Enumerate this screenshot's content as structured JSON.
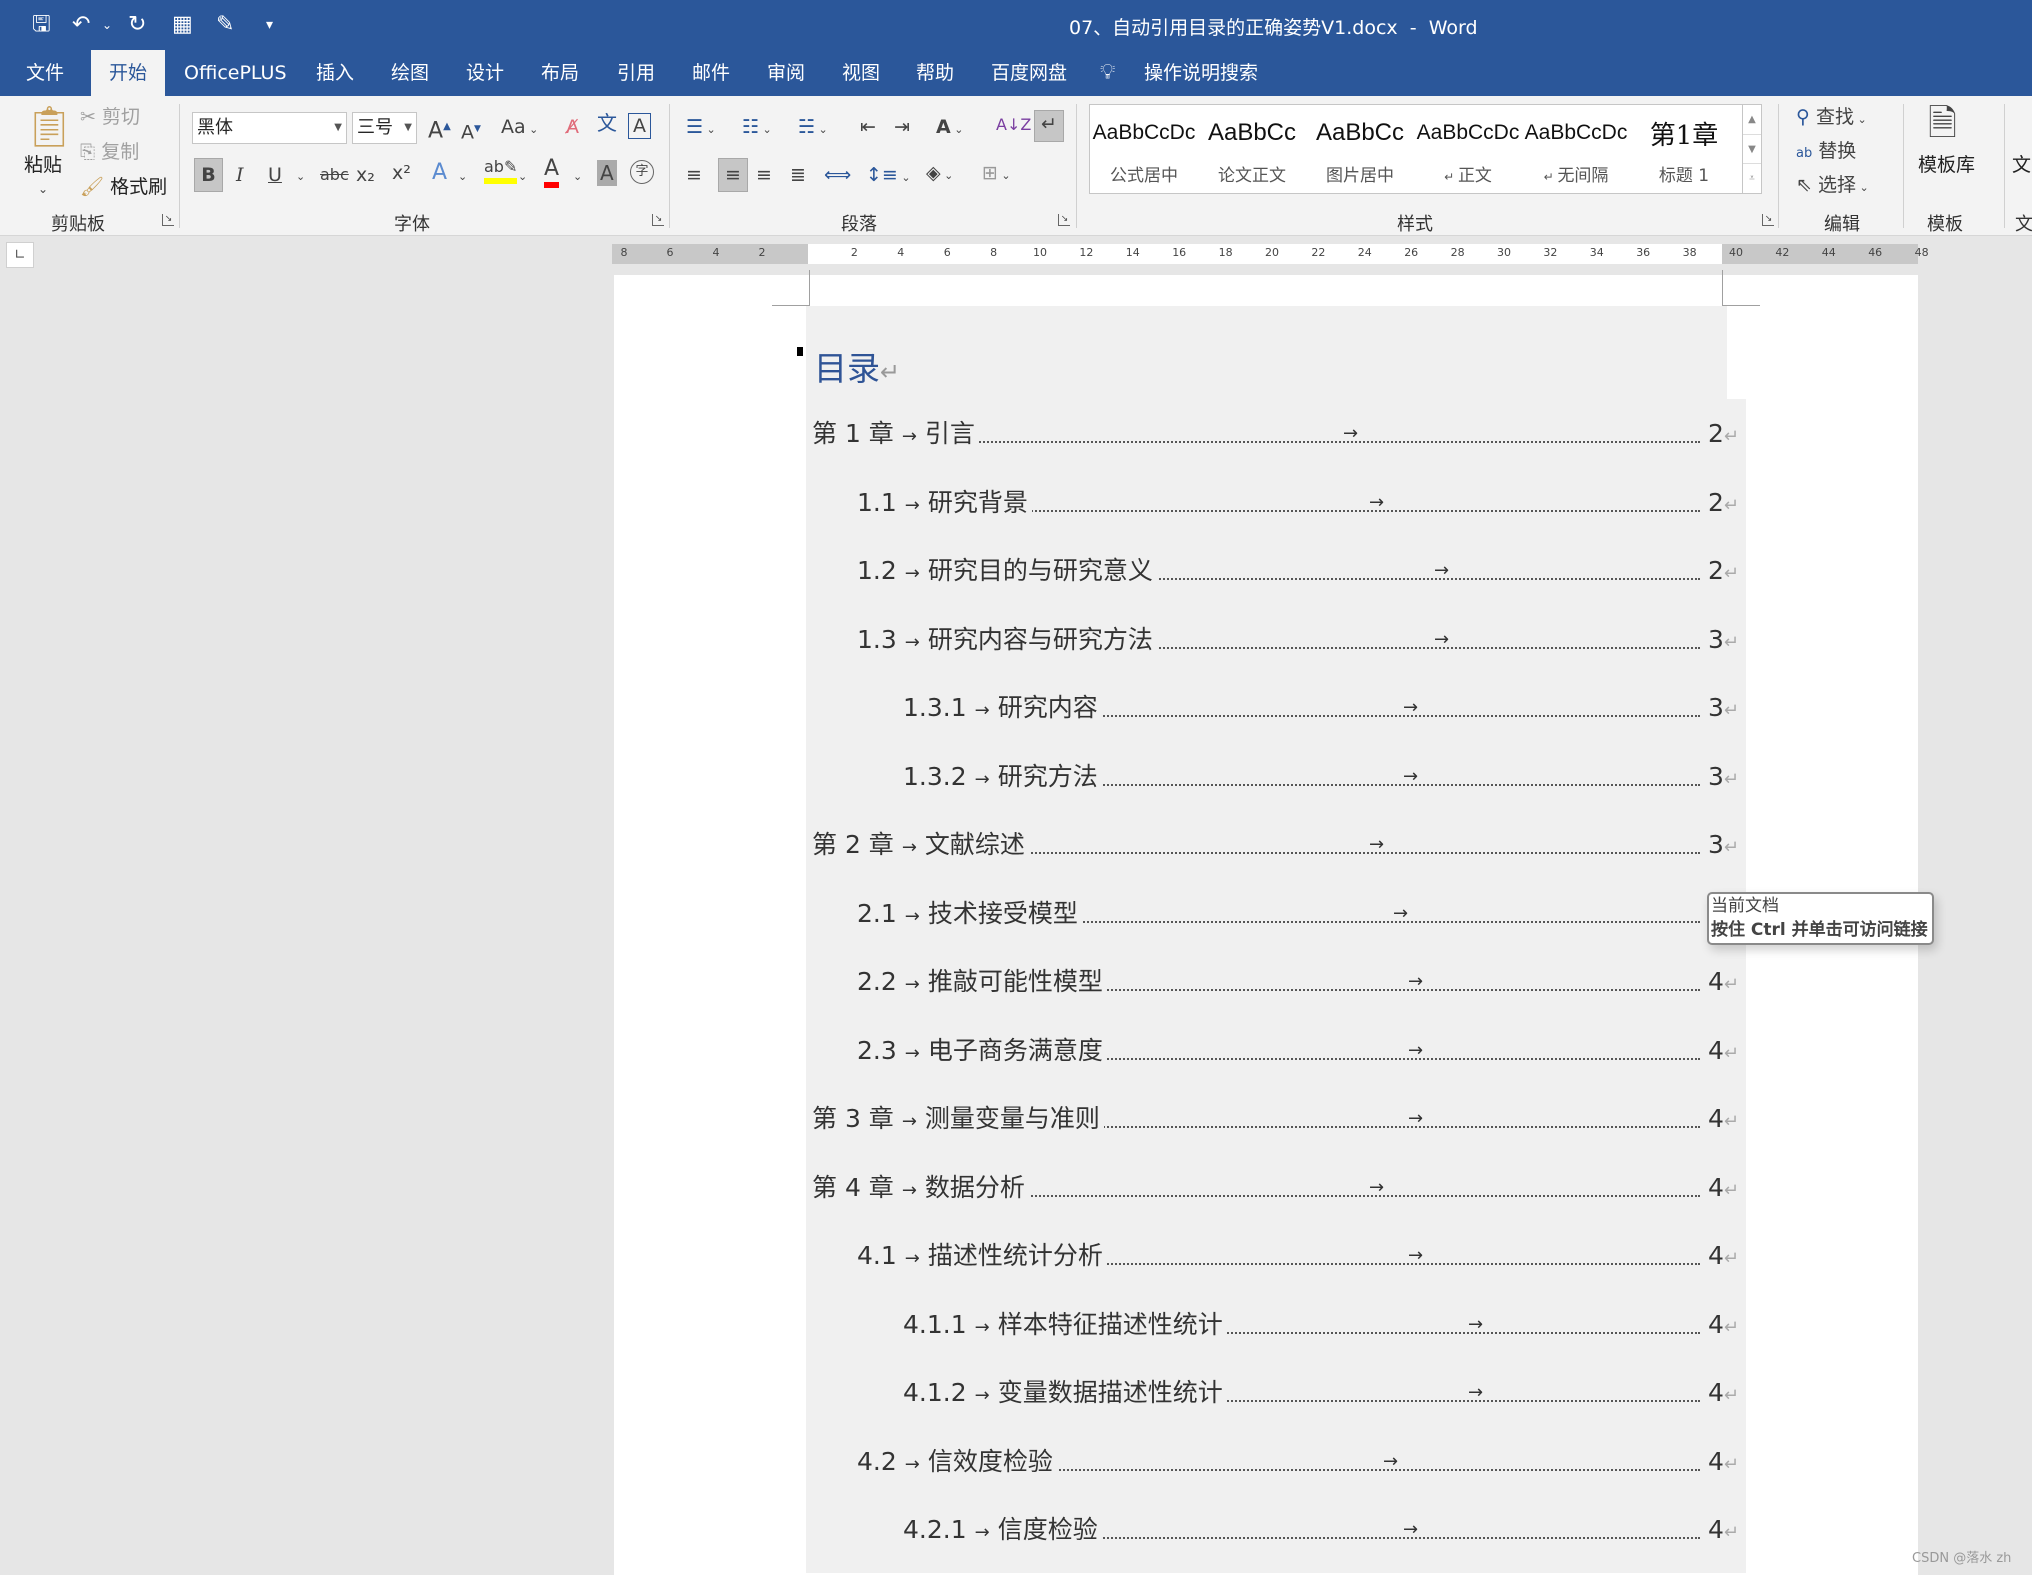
{
  "window": {
    "title": "07、自动引用目录的正确姿势V1.docx  -  Word"
  },
  "qat": [
    "save-icon",
    "undo-icon",
    "redo-icon",
    "table-icon",
    "form-icon",
    "customize-icon"
  ],
  "tabs": [
    "文件",
    "开始",
    "OfficePLUS",
    "插入",
    "绘图",
    "设计",
    "布局",
    "引用",
    "邮件",
    "审阅",
    "视图",
    "帮助",
    "百度网盘"
  ],
  "active_tab": "开始",
  "tell_me": "操作说明搜索",
  "clipboard": {
    "paste": "粘贴",
    "cut": "剪切",
    "copy": "复制",
    "format_painter": "格式刷",
    "label": "剪贴板"
  },
  "font": {
    "name": "黑体",
    "size": "三号",
    "change_case": "Aa",
    "label": "字体",
    "bold": "B",
    "italic": "I",
    "underline": "U",
    "strike": "abc",
    "sub": "x₂",
    "sup": "x²",
    "char_border": "A",
    "phonetic": "文",
    "enclose": "字"
  },
  "paragraph": {
    "label": "段落"
  },
  "styles": {
    "label": "样式",
    "items": [
      {
        "sample": "AaBbCcDc",
        "name": "公式居中"
      },
      {
        "sample": "AaBbCc",
        "name": "论文正文"
      },
      {
        "sample": "AaBbCc",
        "name": "图片居中"
      },
      {
        "sample": "AaBbCcDc",
        "name": "正文"
      },
      {
        "sample": "AaBbCcDc",
        "name": "无间隔"
      },
      {
        "sample": "第1章",
        "name": "标题 1"
      }
    ]
  },
  "editing": {
    "find": "查找",
    "replace": "替换",
    "select": "选择",
    "label": "编辑"
  },
  "template": {
    "library": "模板库",
    "label": "模板"
  },
  "cut_group": {
    "label": "文"
  },
  "ruler": {
    "left": [
      "8",
      "6",
      "4",
      "2"
    ],
    "right": [
      "2",
      "4",
      "6",
      "8",
      "10",
      "12",
      "14",
      "16",
      "18",
      "20",
      "22",
      "24",
      "26",
      "28",
      "30",
      "32",
      "34",
      "36",
      "38",
      "40",
      "42",
      "44",
      "46",
      "48"
    ]
  },
  "toc": {
    "title": "目录",
    "items": [
      {
        "num": "第 1 章",
        "title": "引言",
        "page": "2",
        "level": 1
      },
      {
        "num": "1.1",
        "title": "研究背景",
        "page": "2",
        "level": 2
      },
      {
        "num": "1.2",
        "title": "研究目的与研究意义",
        "page": "2",
        "level": 2
      },
      {
        "num": "1.3",
        "title": "研究内容与研究方法",
        "page": "3",
        "level": 2
      },
      {
        "num": "1.3.1",
        "title": "研究内容",
        "page": "3",
        "level": 3
      },
      {
        "num": "1.3.2",
        "title": "研究方法",
        "page": "3",
        "level": 3
      },
      {
        "num": "第 2 章",
        "title": "文献综述",
        "page": "3",
        "level": 1
      },
      {
        "num": "2.1",
        "title": "技术接受模型",
        "page": "",
        "level": 2
      },
      {
        "num": "2.2",
        "title": "推敲可能性模型",
        "page": "4",
        "level": 2
      },
      {
        "num": "2.3",
        "title": "电子商务满意度",
        "page": "4",
        "level": 2
      },
      {
        "num": "第 3 章",
        "title": "测量变量与准则",
        "page": "4",
        "level": 1
      },
      {
        "num": "第 4 章",
        "title": "数据分析",
        "page": "4",
        "level": 1
      },
      {
        "num": "4.1",
        "title": "描述性统计分析",
        "page": "4",
        "level": 2
      },
      {
        "num": "4.1.1",
        "title": "样本特征描述性统计",
        "page": "4",
        "level": 3
      },
      {
        "num": "4.1.2",
        "title": "变量数据描述性统计",
        "page": "4",
        "level": 3
      },
      {
        "num": "4.2",
        "title": "信效度检验",
        "page": "4",
        "level": 2
      },
      {
        "num": "4.2.1",
        "title": "信度检验",
        "page": "4",
        "level": 3
      }
    ]
  },
  "tooltip": {
    "line1": "当前文档",
    "line2": "按住 Ctrl 并单击可访问链接"
  },
  "watermark": "CSDN @落水 zh",
  "colors": {
    "brand": "#2b579a",
    "heading": "#2f5496",
    "highlight": "#ffff00",
    "font_color": "#ff0000"
  }
}
